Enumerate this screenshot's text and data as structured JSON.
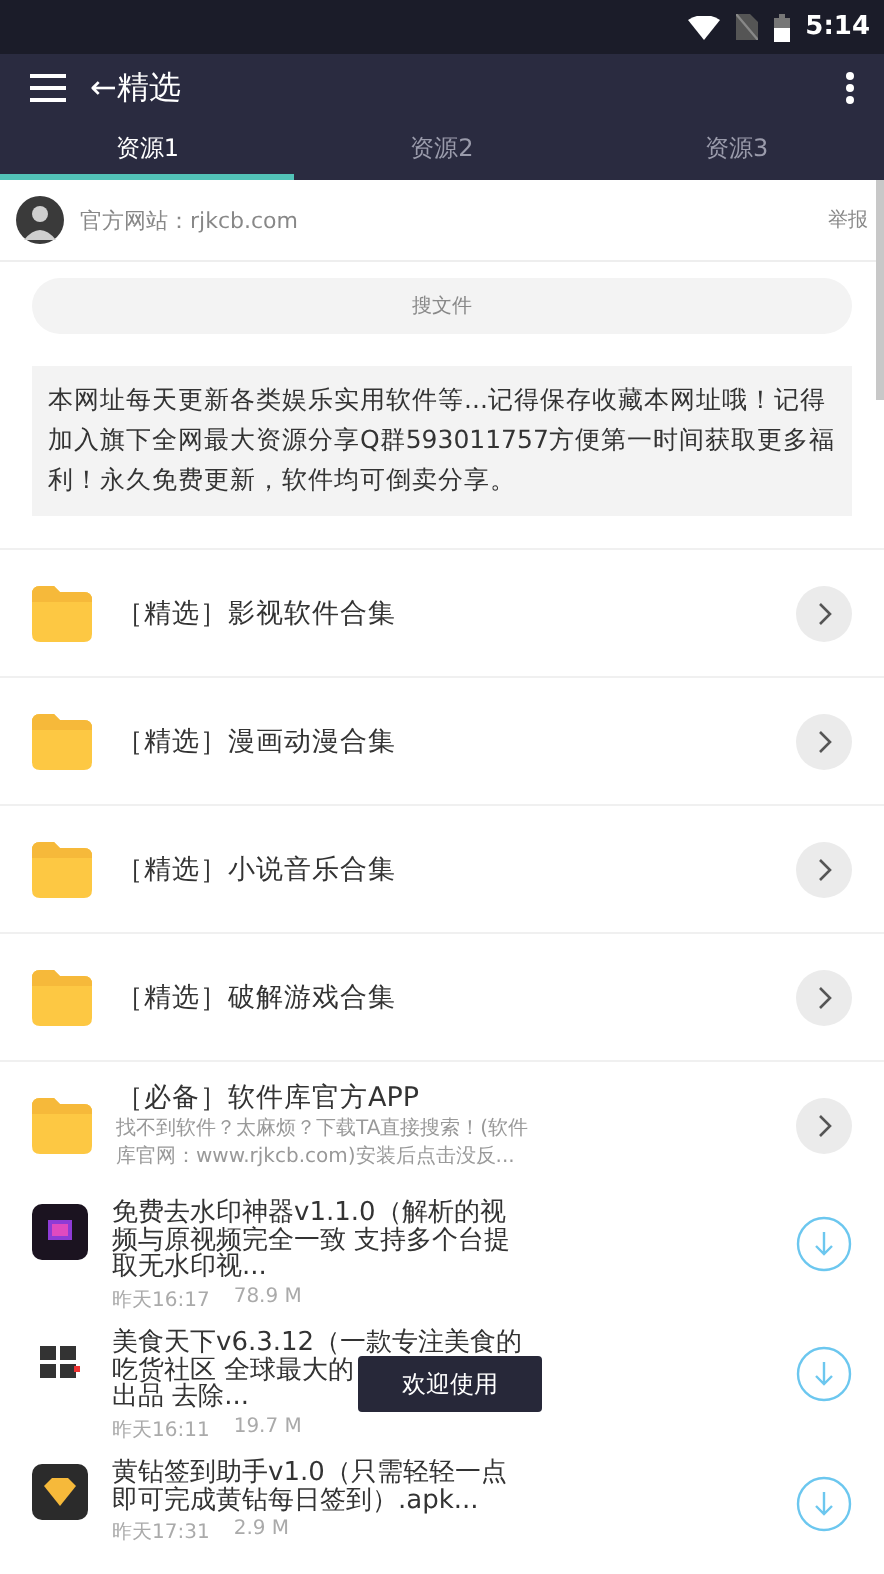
{
  "status_bar": {
    "time": "5:14"
  },
  "app_bar": {
    "title": "←精选"
  },
  "tabs": [
    {
      "label": "资源1",
      "selected": true
    },
    {
      "label": "资源2",
      "selected": false
    },
    {
      "label": "资源3",
      "selected": false
    }
  ],
  "header": {
    "site": "官方网站：rjkcb.com",
    "report": "举报"
  },
  "search": {
    "placeholder": "搜文件"
  },
  "notice": "本网址每天更新各类娱乐实用软件等...记得保存收藏本网址哦！记得加入旗下全网最大资源分享Q群593011757方便第一时间获取更多福利！永久免费更新，软件均可倒卖分享。",
  "folders": [
    {
      "title": "［精选］影视软件合集"
    },
    {
      "title": "［精选］漫画动漫合集"
    },
    {
      "title": "［精选］小说音乐合集"
    },
    {
      "title": "［精选］破解游戏合集"
    },
    {
      "title": "［必备］软件库官方APP",
      "description": "找不到软件？太麻烦？下载TA直接搜索！(软件库官网：www.rjkcb.com)安装后点击没反..."
    }
  ],
  "files": [
    {
      "title_lines": [
        "免费去水印神器v1.1.0（解析的视",
        "频与原视频完全一致 支持多个台提",
        "取无水印视..."
      ],
      "date": "昨天16:17",
      "size": "78.9 M"
    },
    {
      "title_lines": [
        "美食天下v6.3.12（一款专注美食的",
        "吃货社区 全球最大的",
        "出品 去除..."
      ],
      "date": "昨天16:11",
      "size": "19.7 M"
    },
    {
      "title_lines": [
        "黄钻签到助手v1.0（只需轻轻一点",
        "即可完成黄钻每日签到）.apk..."
      ],
      "date": "昨天17:31",
      "size": "2.9 M"
    }
  ],
  "toast": "欢迎使用"
}
